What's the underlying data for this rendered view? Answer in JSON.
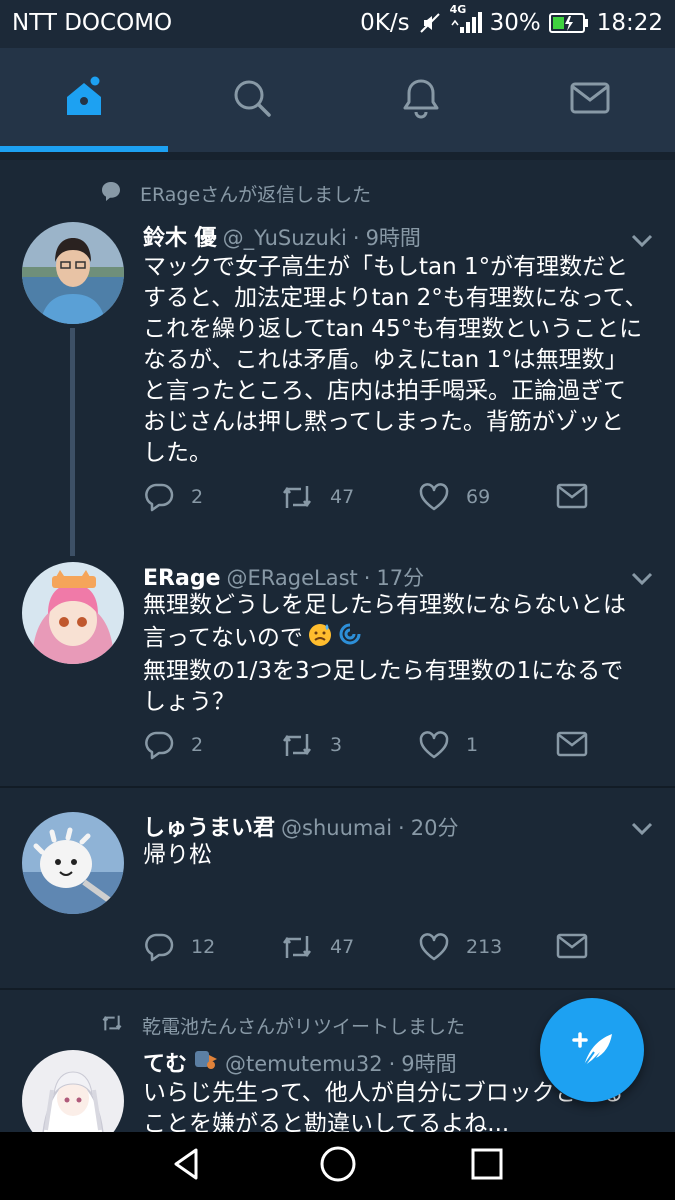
{
  "status_bar": {
    "carrier": "NTT DOCOMO",
    "speed": "0K/s",
    "network": "4G",
    "battery": "30%",
    "time": "18:22"
  },
  "nav_tabs": [
    {
      "icon": "home-icon",
      "active": true
    },
    {
      "icon": "search-icon",
      "active": false
    },
    {
      "icon": "bell-icon",
      "active": false
    },
    {
      "icon": "mail-icon",
      "active": false
    }
  ],
  "tweets": [
    {
      "context": "ERageさんが返信しました",
      "context_icon": "reply-bubble-icon",
      "name": "鈴木 優",
      "handle": "@_YuSuzuki",
      "dot": "·",
      "time": "9時間",
      "lines": [
        "マックで女子高生が「もしtan 1°が有理数だと",
        "すると、加法定理よりtan 2°も有理数になって、",
        "これを繰り返してtan 45°も有理数ということに",
        "なるが、これは矛盾。ゆえにtan 1°は無理数」",
        "と言ったところ、店内は拍手喝采。正論過ぎて",
        "おじさんは押し黙ってしまった。背筋がゾッと",
        "した。"
      ],
      "replies": "2",
      "retweets": "47",
      "likes": "69"
    },
    {
      "name": "ERage",
      "handle": "@ERageLast",
      "dot": "·",
      "time": "17分",
      "lines": [
        "無理数どうしを足したら有理数にならないとは",
        "言ってないので",
        "無理数の1/3を3つ足したら有理数の1になるで",
        "しょう？"
      ],
      "replies": "2",
      "retweets": "3",
      "likes": "1"
    },
    {
      "name": "しゅうまい君",
      "handle": "@shuumai",
      "dot": "·",
      "time": "20分",
      "lines": [
        "帰り松"
      ],
      "replies": "12",
      "retweets": "47",
      "likes": "213"
    },
    {
      "context": "乾電池たんさんがリツイートしました",
      "context_icon": "retweet-icon",
      "name": "てむ",
      "handle": "@temutemu32",
      "dot": "·",
      "time": "9時間",
      "lines": [
        "いらじ先生って、他人が自分にブロックされる",
        "ことを嫌がると勘違いしてるよね..."
      ]
    }
  ],
  "colors": {
    "background": "#1b2836",
    "header": "#243447",
    "accent": "#1da1f2",
    "muted": "#8899a6",
    "divider": "#121c26"
  }
}
